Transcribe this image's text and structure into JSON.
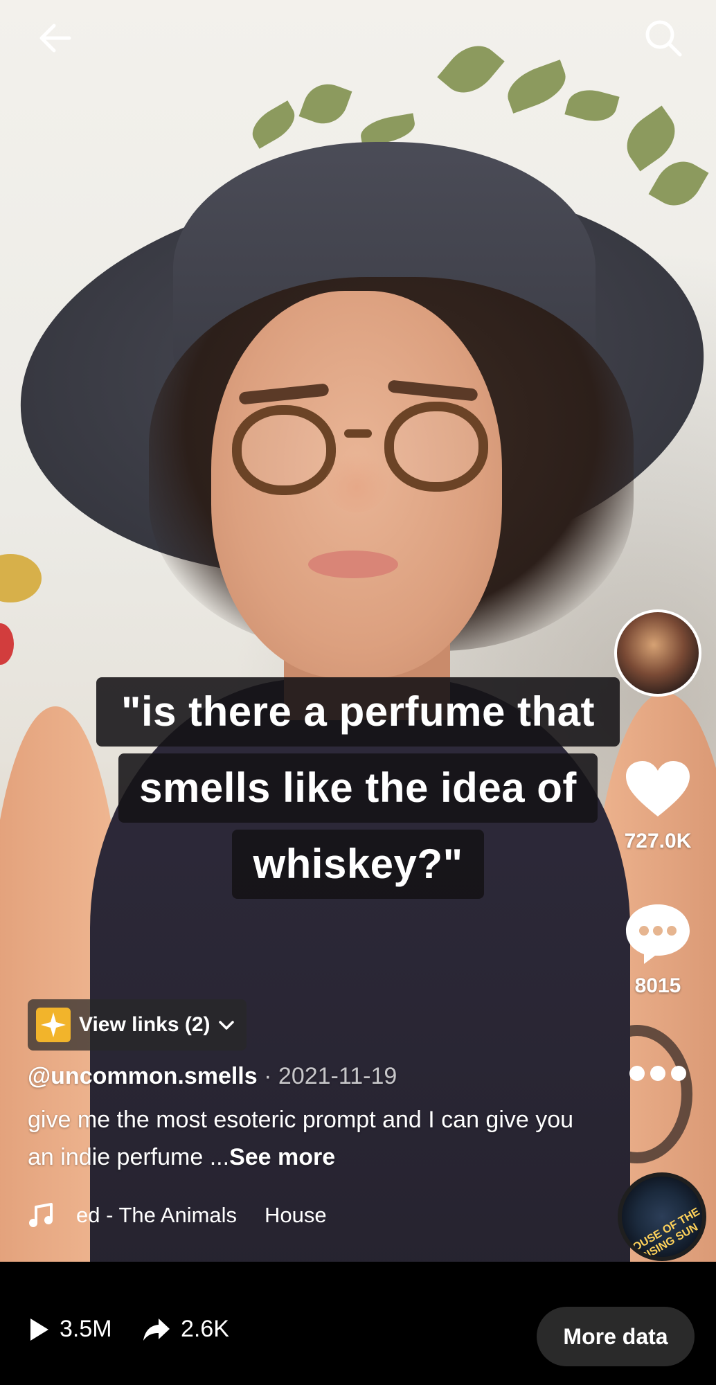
{
  "caption": {
    "lines": [
      "\"is there a perfume that",
      "smells like the idea of",
      "whiskey?\""
    ]
  },
  "right_rail": {
    "likes": "727.0K",
    "comments": "8015"
  },
  "links": {
    "label": "View links (2)"
  },
  "post": {
    "handle": "@uncommon.smells",
    "separator": "·",
    "date": "2021-11-19",
    "description": "give me the most esoteric prompt and I can give you an indie perfume ...",
    "see_more": "See more"
  },
  "music": {
    "track_part1": "ed - The Animals",
    "track_part2": "House",
    "disc_text": "HOUSE OF THE RISING SUN"
  },
  "stats": {
    "plays": "3.5M",
    "shares": "2.6K",
    "more_data_label": "More data"
  },
  "icons": {
    "back": "arrow-left-icon",
    "search": "search-icon",
    "like": "heart-icon",
    "comment": "comment-bubble-icon",
    "more": "ellipsis-icon",
    "links": "sparkle-icon",
    "music": "music-note-icon",
    "play": "play-icon",
    "share": "share-arrow-icon"
  },
  "colors": {
    "links_icon_bg": "#f2b42b",
    "caption_bg": "#141216",
    "more_data_bg": "#2a2a2a"
  }
}
